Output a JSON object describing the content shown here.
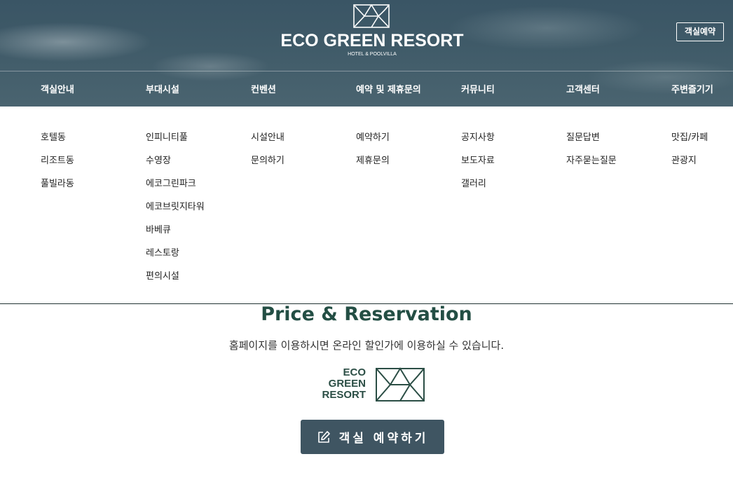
{
  "header": {
    "brand_name": "ECO GREEN RESORT",
    "brand_sub": "HOTEL & POOLVILLA",
    "reserve_button": "객실예약"
  },
  "nav": [
    {
      "label": "객실안내",
      "items": [
        "호텔동",
        "리조트동",
        "풀빌라동"
      ]
    },
    {
      "label": "부대시설",
      "items": [
        "인피니티풀",
        "수영장",
        "에코그린파크",
        "에코브릿지타워",
        "바베큐",
        "레스토랑",
        "편의시설"
      ]
    },
    {
      "label": "컨벤션",
      "items": [
        "시설안내",
        "문의하기"
      ]
    },
    {
      "label": "예약 및 제휴문의",
      "items": [
        "예약하기",
        "제휴문의"
      ]
    },
    {
      "label": "커뮤니티",
      "items": [
        "공지사항",
        "보도자료",
        "갤러리"
      ]
    },
    {
      "label": "고객센터",
      "items": [
        "질문답변",
        "자주묻는질문"
      ]
    },
    {
      "label": "주변즐기기",
      "items": [
        "맛집/카페",
        "관광지"
      ]
    }
  ],
  "price_section": {
    "title": "Price & Reservation",
    "description": "홈페이지를 이용하시면 온라인 할인가에 이용하실 수 있습니다.",
    "logo_lines": [
      "ECO",
      "GREEN",
      "RESORT"
    ],
    "book_button": "객실 예약하기"
  },
  "colors": {
    "header_bg": "#3f5a68",
    "title_green": "#234e44",
    "button_bg": "#3f5562"
  }
}
